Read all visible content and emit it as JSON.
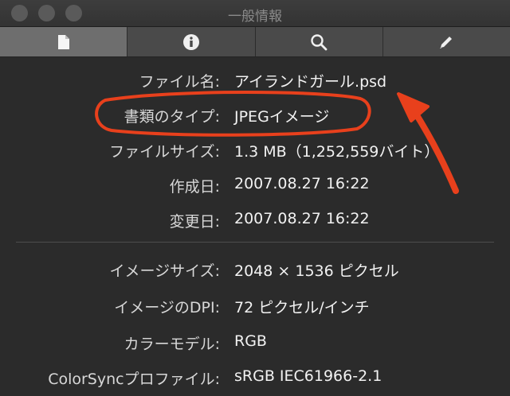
{
  "window": {
    "title": "一般情報"
  },
  "tabs": [
    {
      "icon": "document-icon",
      "active": true
    },
    {
      "icon": "info-icon",
      "active": false
    },
    {
      "icon": "search-icon",
      "active": false
    },
    {
      "icon": "pencil-icon",
      "active": false
    }
  ],
  "info": {
    "filename": {
      "label": "ファイル名:",
      "value": "アイランドガール.psd"
    },
    "kind": {
      "label": "書類のタイプ:",
      "value": "JPEGイメージ"
    },
    "size": {
      "label": "ファイルサイズ:",
      "value": "1.3 MB（1,252,559バイト）"
    },
    "created": {
      "label": "作成日:",
      "value": "2007.08.27 16:22"
    },
    "modified": {
      "label": "変更日:",
      "value": "2007.08.27 16:22"
    },
    "dimensions": {
      "label": "イメージサイズ:",
      "value": "2048 × 1536 ピクセル"
    },
    "dpi": {
      "label": "イメージのDPI:",
      "value": "72 ピクセル/インチ"
    },
    "color_model": {
      "label": "カラーモデル:",
      "value": "RGB"
    },
    "profile": {
      "label": "ColorSyncプロファイル:",
      "value": "sRGB IEC61966-2.1"
    }
  },
  "annotation": {
    "color": "#e8401c"
  }
}
